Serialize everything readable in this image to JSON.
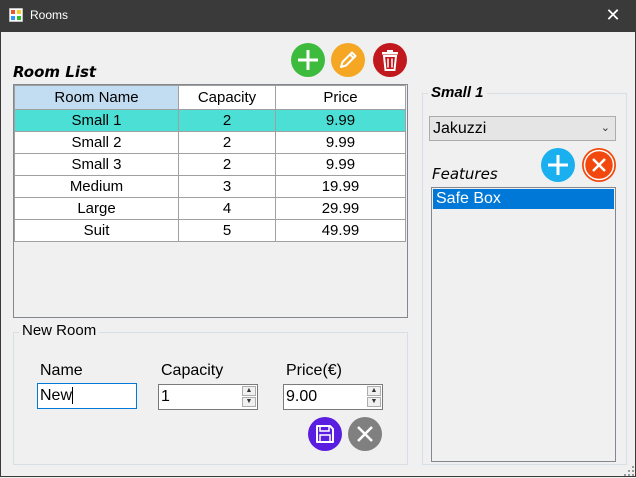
{
  "window": {
    "title": "Rooms",
    "close_glyph": "✕"
  },
  "room_list": {
    "heading": "Room List",
    "columns": [
      "Room Name",
      "Capacity",
      "Price"
    ],
    "rows": [
      {
        "name": "Small 1",
        "capacity": "2",
        "price": "9.99",
        "selected": true
      },
      {
        "name": "Small 2",
        "capacity": "2",
        "price": "9.99"
      },
      {
        "name": "Small 3",
        "capacity": "2",
        "price": "9.99"
      },
      {
        "name": "Medium",
        "capacity": "3",
        "price": "19.99"
      },
      {
        "name": "Large",
        "capacity": "4",
        "price": "29.99"
      },
      {
        "name": "Suit",
        "capacity": "5",
        "price": "49.99"
      }
    ],
    "buttons": {
      "add": "add-icon",
      "edit": "pencil-icon",
      "delete": "trash-icon"
    }
  },
  "new_room": {
    "legend": "New Room",
    "name_label": "Name",
    "name_value": "New",
    "capacity_label": "Capacity",
    "capacity_value": "1",
    "price_label": "Price(€)",
    "price_value": "9.00"
  },
  "room_detail": {
    "legend": "Small 1",
    "combo_value": "Jakuzzi",
    "features_label": "Features",
    "features": [
      "Safe Box"
    ]
  },
  "colors": {
    "selected_row": "#4cdfd6",
    "add_green": "#3dbb3d",
    "edit_orange": "#f5a623",
    "delete_red": "#c0181c",
    "feature_add": "#1ab0f0",
    "feature_remove": "#f2480e",
    "save_purple": "#5a1ee0",
    "cancel_gray": "#808080",
    "list_selection": "#0078d7"
  }
}
